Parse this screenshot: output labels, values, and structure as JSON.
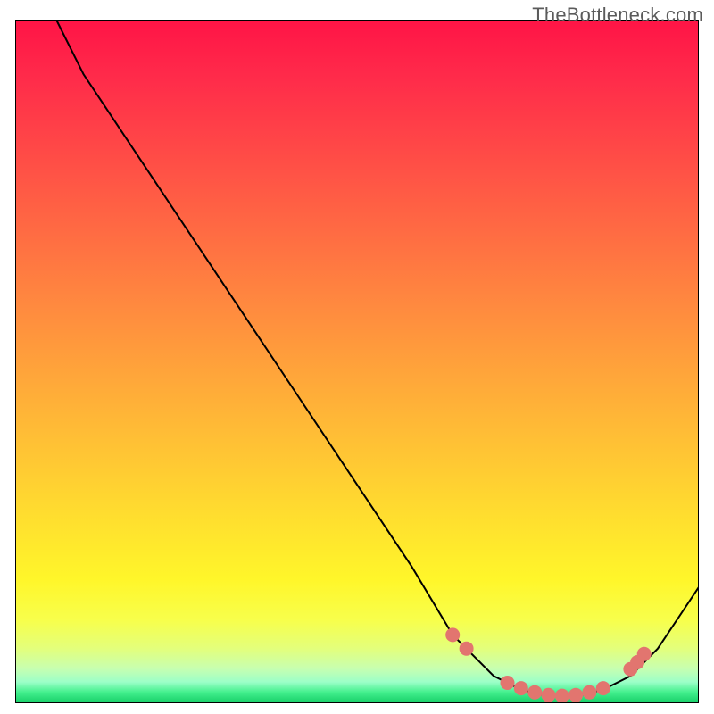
{
  "attribution": "TheBottleneck.com",
  "chart_data": {
    "type": "line",
    "title": "",
    "xlabel": "",
    "ylabel": "",
    "xlim": [
      0,
      100
    ],
    "ylim": [
      0,
      100
    ],
    "background": "heatmap-gradient",
    "gradient_stops": [
      {
        "pos": 0,
        "color": "#ff1446"
      },
      {
        "pos": 0.5,
        "color": "#ffb637"
      },
      {
        "pos": 0.82,
        "color": "#fff62a"
      },
      {
        "pos": 1.0,
        "color": "#18d06a"
      }
    ],
    "series": [
      {
        "name": "bottleneck-curve",
        "x": [
          6,
          10,
          20,
          30,
          40,
          50,
          58,
          64,
          70,
          74,
          78,
          82,
          86,
          90,
          94,
          100
        ],
        "y": [
          100,
          92,
          77,
          62,
          47,
          32,
          20,
          10,
          4,
          2,
          1,
          1,
          2,
          4,
          8,
          17
        ],
        "color": "#000000",
        "line_width": 2
      }
    ],
    "markers": [
      {
        "name": "optimal-range-dots",
        "shape": "circle",
        "color": "#e2756f",
        "radius_px": 8,
        "points": [
          {
            "x": 64,
            "y": 10
          },
          {
            "x": 66,
            "y": 8
          },
          {
            "x": 72,
            "y": 3
          },
          {
            "x": 74,
            "y": 2.2
          },
          {
            "x": 76,
            "y": 1.6
          },
          {
            "x": 78,
            "y": 1.2
          },
          {
            "x": 80,
            "y": 1.1
          },
          {
            "x": 82,
            "y": 1.2
          },
          {
            "x": 84,
            "y": 1.6
          },
          {
            "x": 86,
            "y": 2.2
          },
          {
            "x": 90,
            "y": 5
          },
          {
            "x": 91,
            "y": 6
          },
          {
            "x": 92,
            "y": 7.2
          }
        ]
      }
    ]
  }
}
